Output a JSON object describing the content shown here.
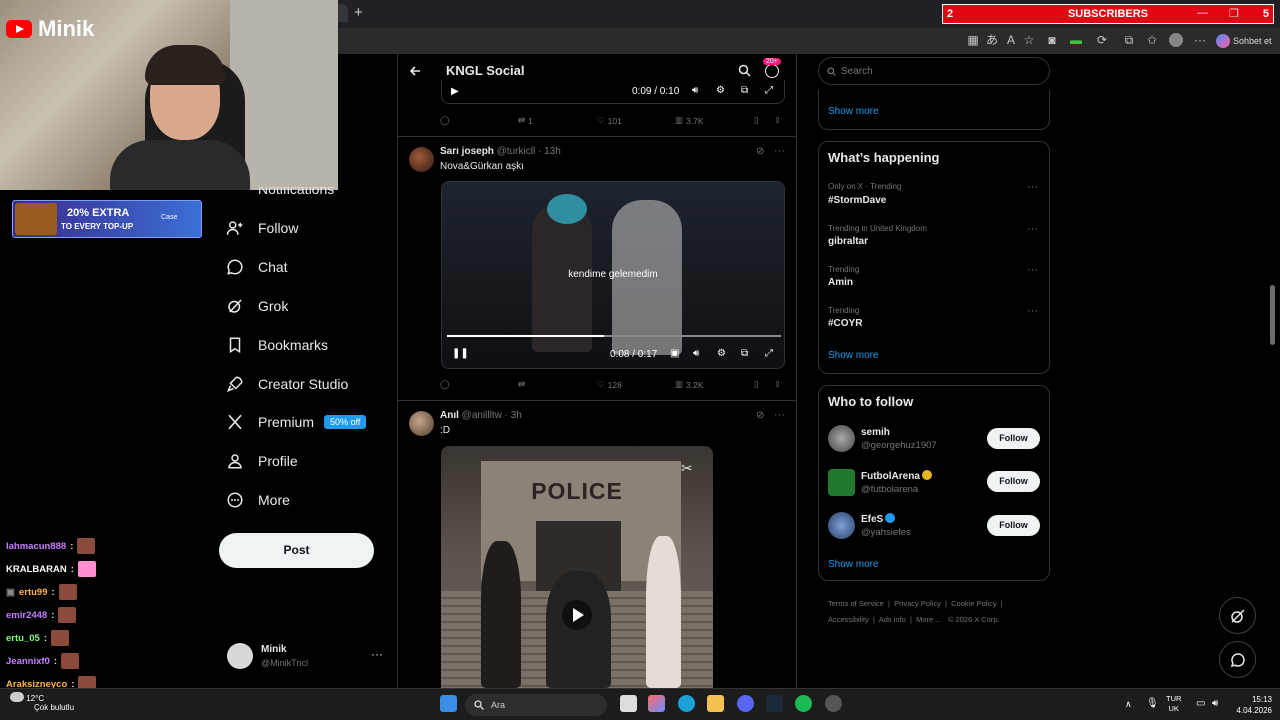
{
  "stream": {
    "channel_name": "Minik",
    "subscribers_label": "SUBSCRIBERS",
    "subscribers_count": "2",
    "subscribers_goal": "5",
    "promo": {
      "headline": "20% EXTRA",
      "subline": "TO EVERY TOP-UP",
      "brand": "Case"
    },
    "chat": [
      {
        "user": "lahmacun888",
        "color": "#c77dff"
      },
      {
        "user": "KRALBARAN",
        "color": "#ffffff"
      },
      {
        "user": "ertu99",
        "color": "#ffb347"
      },
      {
        "user": "emir2448",
        "color": "#c77dff"
      },
      {
        "user": "ertu_05",
        "color": "#7fff7f"
      },
      {
        "user": "Jeannixf0",
        "color": "#c77dff"
      },
      {
        "user": "Araksizneyco",
        "color": "#ffb347"
      }
    ]
  },
  "browser": {
    "new_tab": "+",
    "sidebar_button": "Sohbet et"
  },
  "nav": {
    "items": [
      {
        "label": "Notifications",
        "icon": "bell-icon"
      },
      {
        "label": "Follow",
        "icon": "person-plus-icon"
      },
      {
        "label": "Chat",
        "icon": "chat-bubble-icon"
      },
      {
        "label": "Grok",
        "icon": "grok-icon"
      },
      {
        "label": "Bookmarks",
        "icon": "bookmark-icon"
      },
      {
        "label": "Creator Studio",
        "icon": "rocket-icon"
      },
      {
        "label": "Premium",
        "icon": "x-logo-icon",
        "badge": "50% off"
      },
      {
        "label": "Profile",
        "icon": "person-icon"
      },
      {
        "label": "More",
        "icon": "more-circle-icon"
      }
    ],
    "post_button": "Post",
    "account": {
      "name": "Minik",
      "handle": "@MinikTncl"
    }
  },
  "feed": {
    "title": "KNGL Social",
    "notif_badge": "20+",
    "top_video": {
      "time": "0:09 / 0:10",
      "retweets": "1",
      "likes": "101",
      "views": "3.7K"
    },
    "tweets": [
      {
        "author": "Sarı joseph",
        "handle": "@turkicll",
        "time": "13h",
        "text": "Nova&Gürkan aşkı",
        "video_subtitle": "kendime gelemedim",
        "video_time": "0:08 / 0:17",
        "video_progress": 0.47,
        "likes": "128",
        "views": "3.2K"
      },
      {
        "author": "Anıl",
        "handle": "@anillltw",
        "time": "3h",
        "text": ":D",
        "image_sign": "POLICE"
      }
    ]
  },
  "right": {
    "search_placeholder": "Search",
    "show_more": "Show more",
    "whats_happening": {
      "title": "What’s happening",
      "trends": [
        {
          "meta": "Only on X · Trending",
          "name": "#StormDave"
        },
        {
          "meta": "Trending in United Kingdom",
          "name": "gibraltar"
        },
        {
          "meta": "Trending",
          "name": "Amin"
        },
        {
          "meta": "Trending",
          "name": "#COYR"
        }
      ]
    },
    "who_to_follow": {
      "title": "Who to follow",
      "follow_label": "Follow",
      "users": [
        {
          "name": "semih",
          "handle": "@georgehuz1907",
          "verified": false
        },
        {
          "name": "FutbolArena",
          "handle": "@futbolarena",
          "verified": true,
          "verified_color": "#e2b719"
        },
        {
          "name": "EfeS",
          "handle": "@yahsiefes",
          "verified": true,
          "verified_color": "#1d9bf0"
        }
      ]
    },
    "footer": [
      "Terms of Service",
      "Privacy Policy",
      "Cookie Policy",
      "Accessibility",
      "Ads info",
      "More ...",
      "© 2026 X Corp."
    ]
  },
  "taskbar": {
    "weather_temp": "12°C",
    "weather_desc": "Çok bulutlu",
    "search": "Ara",
    "lang": "TUR",
    "lang2": "UK",
    "time": "15:13",
    "date": "4.04.2026"
  }
}
